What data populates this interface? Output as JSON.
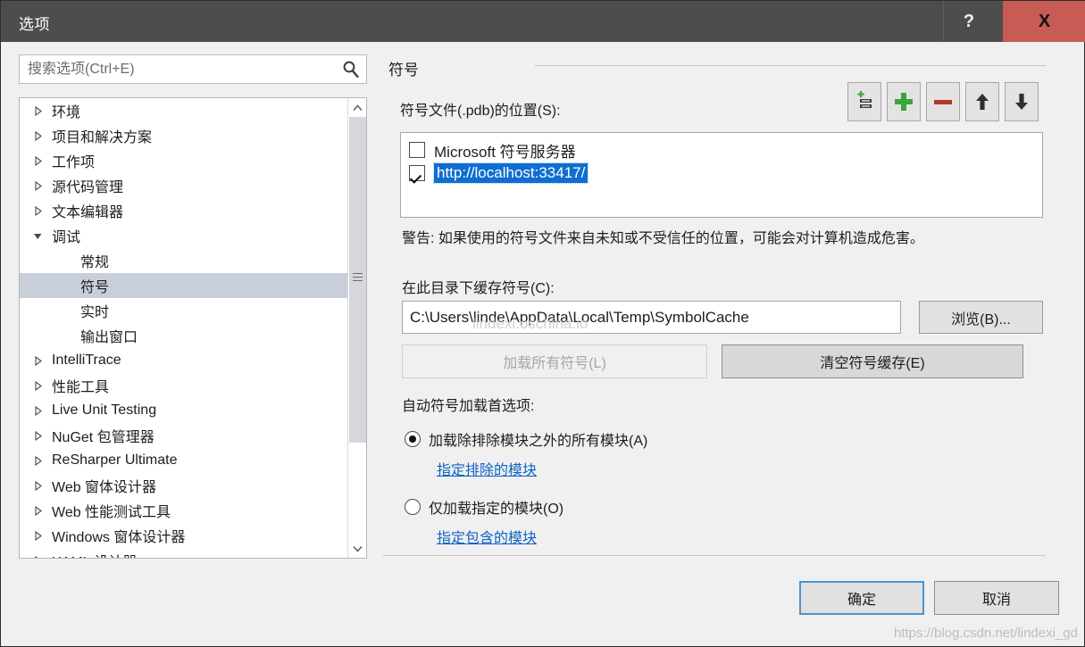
{
  "window": {
    "title": "选项",
    "help_label": "?",
    "close_label": "X",
    "titlebar_color": "#4d4d4d",
    "close_color": "#c75c55"
  },
  "search": {
    "placeholder": "搜索选项(Ctrl+E)",
    "value": "",
    "icon": "search-icon"
  },
  "tree": {
    "selected": "符号",
    "selection_color": "#c9cedb",
    "items": [
      {
        "label": "环境",
        "level": 0,
        "expander": "collapsed"
      },
      {
        "label": "项目和解决方案",
        "level": 0,
        "expander": "collapsed"
      },
      {
        "label": "工作项",
        "level": 0,
        "expander": "collapsed"
      },
      {
        "label": "源代码管理",
        "level": 0,
        "expander": "collapsed"
      },
      {
        "label": "文本编辑器",
        "level": 0,
        "expander": "collapsed"
      },
      {
        "label": "调试",
        "level": 0,
        "expander": "expanded"
      },
      {
        "label": "常规",
        "level": 1,
        "expander": "none"
      },
      {
        "label": "符号",
        "level": 1,
        "expander": "none",
        "selected": true
      },
      {
        "label": "实时",
        "level": 1,
        "expander": "none"
      },
      {
        "label": "输出窗口",
        "level": 1,
        "expander": "none"
      },
      {
        "label": "IntelliTrace",
        "level": 0,
        "expander": "collapsed"
      },
      {
        "label": "性能工具",
        "level": 0,
        "expander": "collapsed"
      },
      {
        "label": "Live Unit Testing",
        "level": 0,
        "expander": "collapsed"
      },
      {
        "label": "NuGet 包管理器",
        "level": 0,
        "expander": "collapsed"
      },
      {
        "label": "ReSharper Ultimate",
        "level": 0,
        "expander": "collapsed"
      },
      {
        "label": "Web 窗体设计器",
        "level": 0,
        "expander": "collapsed"
      },
      {
        "label": "Web 性能测试工具",
        "level": 0,
        "expander": "collapsed"
      },
      {
        "label": "Windows 窗体设计器",
        "level": 0,
        "expander": "collapsed"
      },
      {
        "label": "XAML 设计器",
        "level": 0,
        "expander": "collapsed"
      }
    ],
    "scrollbar": {
      "up_icon": "chevron-up-icon",
      "down_icon": "chevron-down-icon",
      "grip_icon": "grip-lines-icon"
    }
  },
  "panel": {
    "title": "符号",
    "location_label": "符号文件(.pdb)的位置(S):",
    "toolbar": [
      {
        "name": "new-symbol-server-button",
        "icon": "list-add-icon"
      },
      {
        "name": "add-button",
        "icon": "plus-icon",
        "color": "#3aa63a"
      },
      {
        "name": "remove-button",
        "icon": "minus-icon",
        "color": "#b1362c"
      },
      {
        "name": "move-up-button",
        "icon": "arrow-up-icon"
      },
      {
        "name": "move-down-button",
        "icon": "arrow-down-icon"
      }
    ],
    "symbol_servers": [
      {
        "label": "Microsoft 符号服务器",
        "checked": false,
        "selected": false
      },
      {
        "label": "http://localhost:33417/",
        "checked": true,
        "selected": true
      }
    ],
    "selection_color": "#0f6ed0",
    "warning": "警告: 如果使用的符号文件来自未知或不受信任的位置，可能会对计算机造成危害。",
    "cache_label": "在此目录下缓存符号(C):",
    "cache_path": "C:\\Users\\linde\\AppData\\Local\\Temp\\SymbolCache",
    "browse_label": "浏览(B)...",
    "load_all_label": "加载所有符号(L)",
    "load_all_disabled": true,
    "clear_cache_label": "清空符号缓存(E)",
    "auto_load_label": "自动符号加载首选项:",
    "radios": [
      {
        "label": "加载除排除模块之外的所有模块(A)",
        "checked": true,
        "link": "指定排除的模块"
      },
      {
        "label": "仅加载指定的模块(O)",
        "checked": false,
        "link": "指定包含的模块"
      }
    ],
    "link_color": "#1063c4"
  },
  "footer": {
    "ok_label": "确定",
    "cancel_label": "取消",
    "focus_color": "#4c94d0"
  },
  "watermarks": {
    "inline": "lindexi.oschina.io",
    "bottom": "https://blog.csdn.net/lindexi_gd"
  }
}
